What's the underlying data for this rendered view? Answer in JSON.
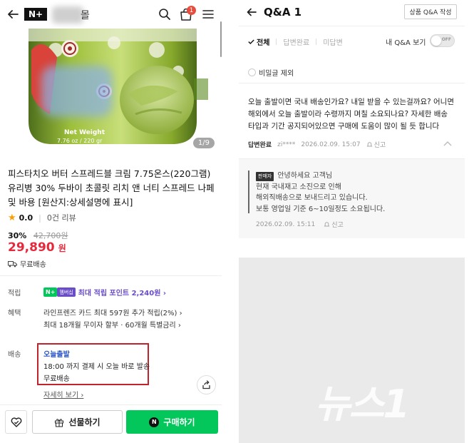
{
  "left": {
    "header": {
      "nplus_logo": "N+",
      "store_name_suffix": "몰",
      "cart_count": "1",
      "icons": [
        "back-arrow-icon",
        "search-icon",
        "shopping-bag-icon",
        "menu-icon"
      ]
    },
    "product": {
      "image_counter": "1/9",
      "image_label_net_weight": "Net Weight",
      "image_label_weight_value": "7.76 oz / 220 gr",
      "title": "피스타치오 버터 스프레드블 크림 7.75온스(220그램) 유리병 30% 두바이 초콜릿 리치 앤 너티 스프레드 나페 및 바용 [원산지:상세설명에 표시]",
      "rating_value": "0.0",
      "review_count": "0건 리뷰",
      "discount_percent": "30%",
      "original_price": "42,700원",
      "price": "29,890",
      "price_unit": "원",
      "shipping": "무료배송"
    },
    "info": {
      "points_label": "적립",
      "points_badge_nplus": "N+",
      "points_badge_member": "멤버십",
      "points_text": "최대 적립 포인트 2,240원 ›",
      "benefit_label": "혜택",
      "benefit_line1": "라인프렌즈 카드 최대 597원 추가 적립(2%) ›",
      "benefit_line2": "최대 18개월 무이자 할부 · 60개월 특별금리 ›",
      "delivery_label": "배송",
      "delivery_line1": "오늘출발",
      "delivery_line2": "18:00 까지 결제 시 오늘 바로 발송",
      "delivery_line3": "무료배송",
      "detail_link": "자세히 보기 ›"
    },
    "bottom": {
      "gift_label": "선물하기",
      "buy_label": "구매하기",
      "buy_n": "N"
    }
  },
  "right": {
    "title": "Q&A 1",
    "write_button": "상품 Q&A 작성",
    "filters": [
      "전체",
      "답변완료",
      "미답변"
    ],
    "my_qa_label": "내 Q&A 보기",
    "toggle_text": "OFF",
    "secret_exclude": "비밀글 제외",
    "question": {
      "text": "오늘 출발이면 국내 배송인가요? 내일 받을 수 있는걸까요? 어니면 해외에서 오늘 출발이라 수령까지 며칠 소요되나요? 자세한 배송 타입과 기간 공지되어있으면 구매에 도움이 많이 될 듯 합니다",
      "status": "답변완료",
      "author": "zi****",
      "date": "2026.02.09. 15:07",
      "report": "신고"
    },
    "answer": {
      "badge": "판매자",
      "greeting": "안녕하세요 고객님",
      "line1": "현재 국내재고 소진으로 인해",
      "line2": "해외직배송으로 보내드리고 있습니다.",
      "line3": "보통 영업일 기준 6~10일정도 소요됩니다.",
      "date": "2026.02.09. 15:11",
      "report": "신고"
    }
  },
  "watermark": "뉴스1",
  "colors": {
    "brand_green": "#03c75a",
    "price_red": "#e5283b",
    "highlight_box": "#c0232c",
    "delivery_blue": "#2a55c9",
    "member_purple": "#6a4dc8"
  }
}
